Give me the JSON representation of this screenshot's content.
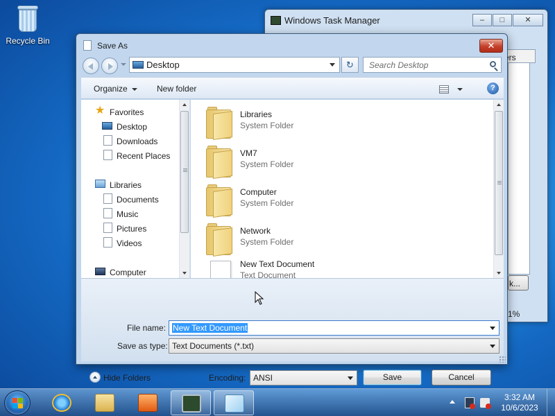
{
  "desktop": {
    "recycle_bin_label": "Recycle Bin"
  },
  "task_manager": {
    "title": "Windows Task Manager",
    "tab_fragment": "ers",
    "button_fragment": "k...",
    "percent_fragment": "1%"
  },
  "save_dialog": {
    "title": "Save As",
    "close_label": "✕",
    "address": "Desktop",
    "refresh_symbol": "↻",
    "search_placeholder": "Search Desktop",
    "toolbar": {
      "organize": "Organize",
      "new_folder": "New folder",
      "help": "?"
    },
    "nav_pane": {
      "items": [
        {
          "label": "Favorites",
          "icon": "star-icon"
        },
        {
          "label": "Desktop",
          "icon": "desktop-icon"
        },
        {
          "label": "Downloads",
          "icon": "folder-icon"
        },
        {
          "label": "Recent Places",
          "icon": "folder-icon"
        },
        {
          "label": "Libraries",
          "icon": "libraries-icon"
        },
        {
          "label": "Documents",
          "icon": "folder-icon"
        },
        {
          "label": "Music",
          "icon": "folder-icon"
        },
        {
          "label": "Pictures",
          "icon": "folder-icon"
        },
        {
          "label": "Videos",
          "icon": "folder-icon"
        },
        {
          "label": "Computer",
          "icon": "computer-icon"
        }
      ]
    },
    "files": [
      {
        "name": "Libraries",
        "type": "System Folder",
        "icon": "folder-icon"
      },
      {
        "name": "VM7",
        "type": "System Folder",
        "icon": "folder-icon"
      },
      {
        "name": "Computer",
        "type": "System Folder",
        "icon": "folder-icon"
      },
      {
        "name": "Network",
        "type": "System Folder",
        "icon": "folder-icon"
      },
      {
        "name": "New Text Document",
        "type": "Text Document",
        "icon": "text-document-icon"
      }
    ],
    "file_name_label": "File name:",
    "file_name_value": "New Text Document",
    "save_as_type_label": "Save as type:",
    "save_as_type_value": "Text Documents (*.txt)",
    "hide_folders": "Hide Folders",
    "encoding_label": "Encoding:",
    "encoding_value": "ANSI",
    "save_button": "Save",
    "cancel_button": "Cancel"
  },
  "taskbar": {
    "apps": [
      "internet-explorer-icon",
      "windows-explorer-icon",
      "media-player-icon",
      "task-manager-icon",
      "notepad-icon"
    ],
    "clock_time": "3:32 AM",
    "clock_date": "10/6/2023"
  }
}
